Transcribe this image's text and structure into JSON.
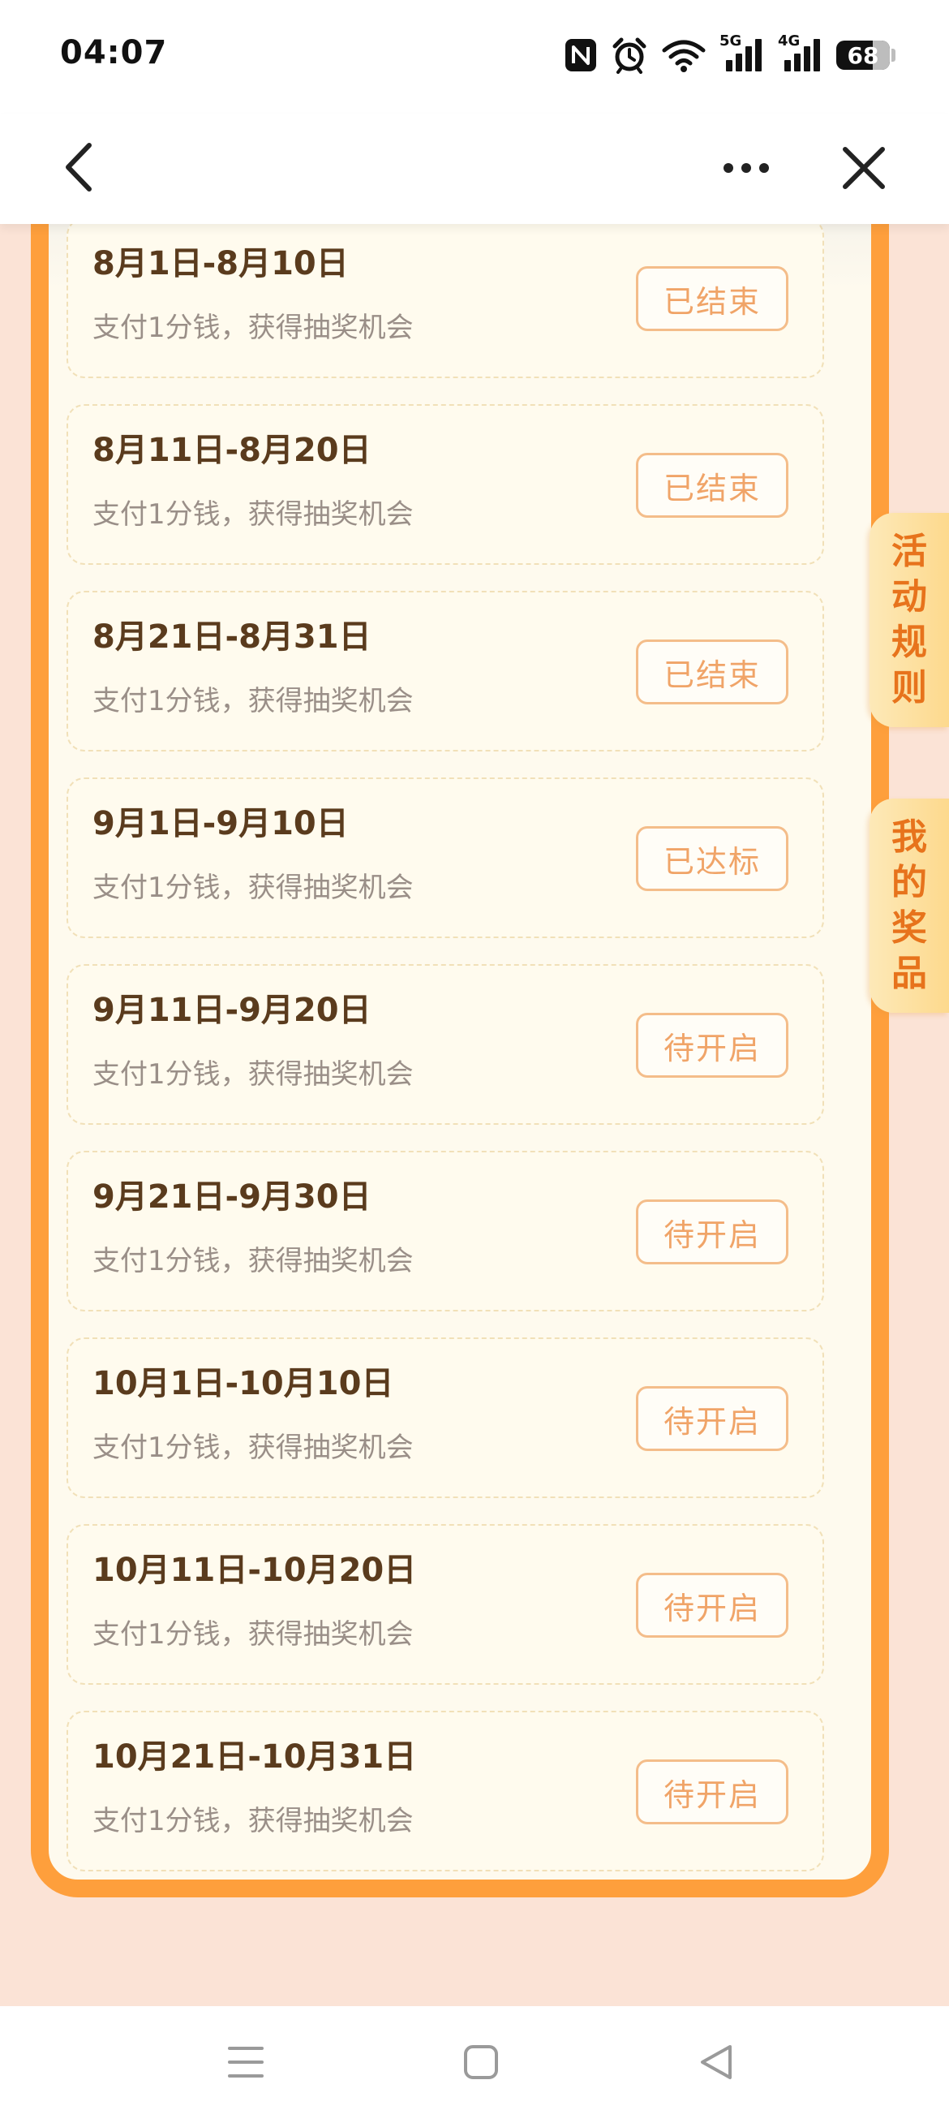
{
  "status_bar": {
    "time": "04:07",
    "net_5g": "5G",
    "net_4g": "4G",
    "battery": "68",
    "battery_level": 0.68,
    "icons": [
      "nfc-icon",
      "alarm-icon",
      "wifi-icon",
      "signal-5g-icon",
      "signal-4g-icon",
      "battery-icon"
    ]
  },
  "nav": {
    "icons": [
      "back-icon",
      "more-icon",
      "close-icon"
    ]
  },
  "periods": [
    {
      "title": "8月1日-8月10日",
      "desc": "支付1分钱，获得抽奖机会",
      "status": "已结束"
    },
    {
      "title": "8月11日-8月20日",
      "desc": "支付1分钱，获得抽奖机会",
      "status": "已结束"
    },
    {
      "title": "8月21日-8月31日",
      "desc": "支付1分钱，获得抽奖机会",
      "status": "已结束"
    },
    {
      "title": "9月1日-9月10日",
      "desc": "支付1分钱，获得抽奖机会",
      "status": "已达标"
    },
    {
      "title": "9月11日-9月20日",
      "desc": "支付1分钱，获得抽奖机会",
      "status": "待开启"
    },
    {
      "title": "9月21日-9月30日",
      "desc": "支付1分钱，获得抽奖机会",
      "status": "待开启"
    },
    {
      "title": "10月1日-10月10日",
      "desc": "支付1分钱，获得抽奖机会",
      "status": "待开启"
    },
    {
      "title": "10月11日-10月20日",
      "desc": "支付1分钱，获得抽奖机会",
      "status": "待开启"
    },
    {
      "title": "10月21日-10月31日",
      "desc": "支付1分钱，获得抽奖机会",
      "status": "待开启"
    }
  ],
  "side_tabs": {
    "rules": "活动规则",
    "prizes": "我的奖品"
  },
  "colors": {
    "accent_orange": "#fe9f3c",
    "panel_bg": "#fefaee",
    "page_bg": "#fbe3d6",
    "title_text": "#5a3b1d",
    "desc_text": "#9a8f88",
    "status_text": "#f0a468",
    "status_border": "#f4bd8a",
    "side_tab_text": "#e7731c"
  },
  "bottom_nav": {
    "icons": [
      "menu-icon",
      "home-icon",
      "back-triangle-icon"
    ]
  }
}
